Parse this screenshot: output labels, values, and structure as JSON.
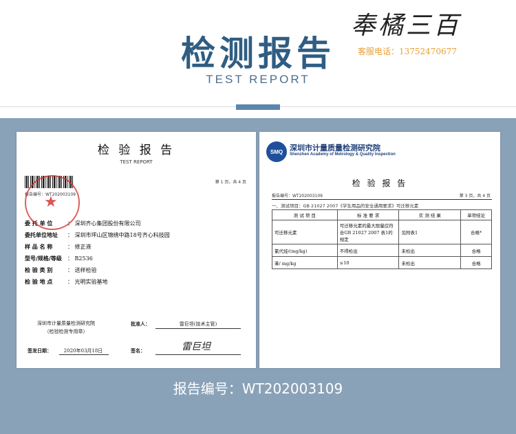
{
  "header": {
    "title": "检测报告",
    "subtitle": "TEST REPORT",
    "brand": "奉橘三百",
    "service_label": "客服电话：13752470677"
  },
  "left_doc": {
    "title": "检 验 报 告",
    "subtitle": "TEST REPORT",
    "page_info": "第 1 页，共 4 页",
    "report_no": "报告编号：WT202003109",
    "fields": [
      {
        "label": "委 托 单 位",
        "value": "：  深圳齐心集团股份有限公司"
      },
      {
        "label": "委托单位地址",
        "value": "：  深圳市坪山区锦绣中路18号齐心科技园"
      },
      {
        "label": "样 品 名 称",
        "value": "：  修正液"
      },
      {
        "label": "型号/规格/等级",
        "value": "：  B2536"
      },
      {
        "label": "检 验 类 别",
        "value": "：  送样检验"
      },
      {
        "label": "检 验 地 点",
        "value": "：  光明实验基地"
      }
    ],
    "stamp_line1": "深圳市计量质量检测研究院",
    "stamp_line2": "（检验检测专用章）",
    "approver_label": "批准人：",
    "approver_value": "雷巨坦(技术主管)",
    "issue_date_label": "签发日期：",
    "issue_date": "2020年03月18日",
    "sign_label": "签名：",
    "signature": "雷巨坦"
  },
  "right_doc": {
    "logo": "SMQ",
    "inst_cn": "深圳市计量质量检测研究院",
    "inst_en": "Shenzhen Academy of Metrology & Quality Inspection",
    "title": "检 验 报 告",
    "report_no": "报告编号：WT202003109",
    "page_info": "第 3 页，共 4 页",
    "section": "一、测试项目：GB 21027 2007《学生用品的安全通用要求》可迁移元素",
    "table": {
      "headers": [
        "测 试 项 目",
        "标 准 要 求",
        "实 测 结 果",
        "单项结论"
      ],
      "rows": [
        [
          "可迁移元素",
          "可迁移元素的最大限量应符合GB 21027 2007 表1的规定",
          "见附表1",
          "合格*"
        ],
        [
          "氯代烃/(mg/kg)",
          "不得检出",
          "未检出",
          "合格"
        ],
        [
          "苯/ mg/kg",
          "≤10",
          "未检出",
          "合格"
        ]
      ]
    }
  },
  "footer": {
    "report_number": "报告编号：WT202003109"
  }
}
